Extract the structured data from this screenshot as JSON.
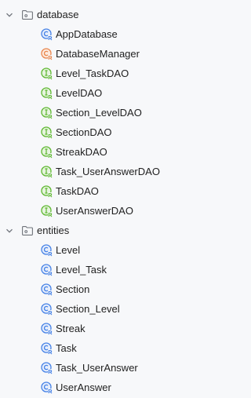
{
  "colors": {
    "background": "#f7f8fa",
    "text": "#1f1f1f",
    "entity_icon": "#4682e6",
    "dao_icon": "#5fb832",
    "abstract_icon": "#e9864e",
    "folder_icon": "#6f737a",
    "chevron": "#6f737a"
  },
  "tree": {
    "folders": [
      {
        "name": "database",
        "expanded": true,
        "items": [
          {
            "label": "AppDatabase",
            "icon": "entity-class-icon"
          },
          {
            "label": "DatabaseManager",
            "icon": "abstract-class-icon"
          },
          {
            "label": "Level_TaskDAO",
            "icon": "interface-class-icon"
          },
          {
            "label": "LevelDAO",
            "icon": "interface-class-icon"
          },
          {
            "label": "Section_LevelDAO",
            "icon": "interface-class-icon"
          },
          {
            "label": "SectionDAO",
            "icon": "interface-class-icon"
          },
          {
            "label": "StreakDAO",
            "icon": "interface-class-icon"
          },
          {
            "label": "Task_UserAnswerDAO",
            "icon": "interface-class-icon"
          },
          {
            "label": "TaskDAO",
            "icon": "interface-class-icon"
          },
          {
            "label": "UserAnswerDAO",
            "icon": "interface-class-icon"
          }
        ]
      },
      {
        "name": "entities",
        "expanded": true,
        "items": [
          {
            "label": "Level",
            "icon": "entity-class-icon"
          },
          {
            "label": "Level_Task",
            "icon": "entity-class-icon"
          },
          {
            "label": "Section",
            "icon": "entity-class-icon"
          },
          {
            "label": "Section_Level",
            "icon": "entity-class-icon"
          },
          {
            "label": "Streak",
            "icon": "entity-class-icon"
          },
          {
            "label": "Task",
            "icon": "entity-class-icon"
          },
          {
            "label": "Task_UserAnswer",
            "icon": "entity-class-icon"
          },
          {
            "label": "UserAnswer",
            "icon": "entity-class-icon"
          }
        ]
      }
    ]
  }
}
